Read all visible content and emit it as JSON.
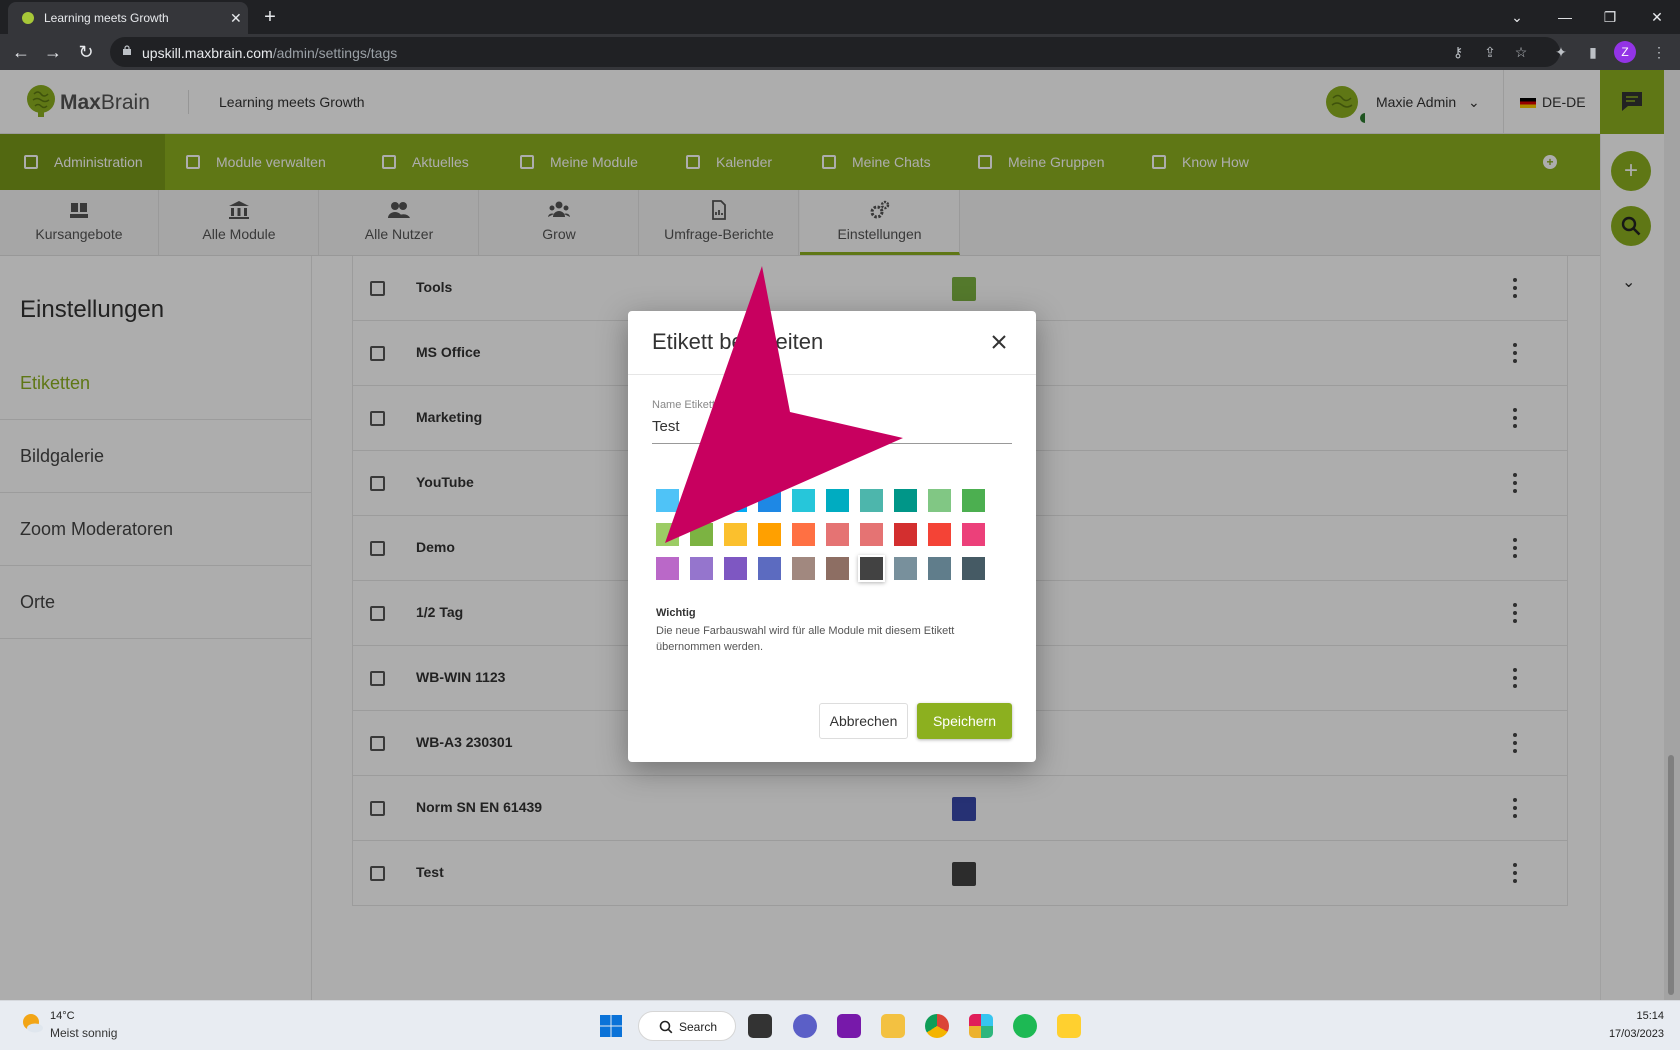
{
  "browser": {
    "tab_title": "Learning meets Growth",
    "url_host": "upskill.maxbrain.com",
    "url_path": "/admin/settings/tags",
    "profile_initial": "Z"
  },
  "header": {
    "logo_max": "Max",
    "logo_brain": "Brain",
    "tagline": "Learning meets Growth",
    "user_name": "Maxie Admin",
    "language": "DE-DE"
  },
  "main_nav": [
    {
      "label": "Administration"
    },
    {
      "label": "Module verwalten"
    },
    {
      "label": "Aktuelles"
    },
    {
      "label": "Meine Module"
    },
    {
      "label": "Kalender"
    },
    {
      "label": "Meine Chats"
    },
    {
      "label": "Meine Gruppen"
    },
    {
      "label": "Know How"
    }
  ],
  "sub_tabs": [
    {
      "label": "Kursangebote"
    },
    {
      "label": "Alle Module"
    },
    {
      "label": "Alle Nutzer"
    },
    {
      "label": "Grow"
    },
    {
      "label": "Umfrage-Berichte"
    },
    {
      "label": "Einstellungen"
    }
  ],
  "sidebar": {
    "title": "Einstellungen",
    "items": [
      {
        "label": "Etiketten"
      },
      {
        "label": "Bildgalerie"
      },
      {
        "label": "Zoom Moderatoren"
      },
      {
        "label": "Orte"
      }
    ]
  },
  "tags": [
    {
      "name": "Tools",
      "color": "#7cb342"
    },
    {
      "name": "MS Office",
      "color": ""
    },
    {
      "name": "Marketing",
      "color": ""
    },
    {
      "name": "YouTube",
      "color": ""
    },
    {
      "name": "Demo",
      "color": ""
    },
    {
      "name": "1/2 Tag",
      "color": ""
    },
    {
      "name": "WB-WIN 1123",
      "color": ""
    },
    {
      "name": "WB-A3 230301",
      "color": ""
    },
    {
      "name": "Norm SN EN 61439",
      "color": "#3949ab"
    },
    {
      "name": "Test",
      "color": "#424242"
    }
  ],
  "modal": {
    "title": "Etikett bearbeiten",
    "field_label": "Name Etikett",
    "field_value": "Test",
    "palette": [
      [
        "#4fc3f7",
        "#29b6f6",
        "#03a9f4",
        "#1e88e5",
        "#26c6da",
        "#00acc1",
        "#4db6ac",
        "#009688",
        "#81c784",
        "#4caf50"
      ],
      [
        "#9ccc65",
        "#7cb342",
        "#fbc02d",
        "#ffa000",
        "#ff7043",
        "#e57373",
        "#e57373",
        "#d32f2f",
        "#f44336",
        "#ec407a"
      ],
      [
        "#ba68c8",
        "#9575cd",
        "#7e57c2",
        "#5c6bc0",
        "#a1887f",
        "#8d6e63",
        "#424242",
        "#78909c",
        "#607d8b",
        "#455a64"
      ]
    ],
    "selected_index": [
      2,
      6
    ],
    "important_title": "Wichtig",
    "important_text": "Die neue Farbauswahl wird für alle Module mit diesem Etikett übernommen werden.",
    "cancel_label": "Abbrechen",
    "save_label": "Speichern"
  },
  "taskbar": {
    "temperature": "14°C",
    "condition": "Meist sonnig",
    "search_label": "Search",
    "time": "15:14",
    "date": "17/03/2023"
  }
}
